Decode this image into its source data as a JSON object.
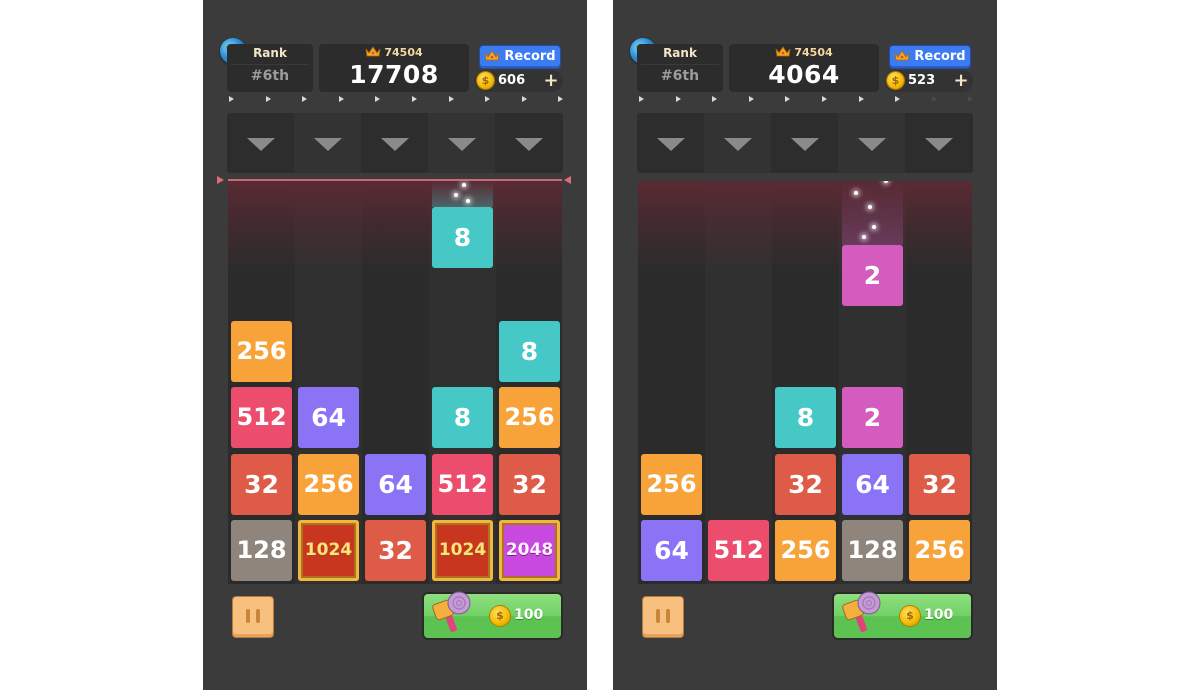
{
  "colors": {
    "tile_2": "#d45cbf",
    "tile_8": "#45c8c6",
    "tile_32": "#dd5b47",
    "tile_64": "#8a74f5",
    "tile_128": "#8f857c",
    "tile_256": "#f7a33a",
    "tile_512": "#ec4d6c",
    "tile_1024": "#c9361f",
    "tile_2048": "#c749e0"
  },
  "screens": [
    {
      "rank_label": "Rank",
      "rank_value": "#6th",
      "best_score": "74504",
      "score": "17708",
      "record_label": "Record",
      "coins": "606",
      "plus_label": "+",
      "progress_arrows_lit": 10,
      "progress_arrows_total": 10,
      "falling_tile": {
        "col": 3,
        "value": "8",
        "color_key": "tile_8"
      },
      "columns": [
        [
          "128",
          "32",
          "512",
          "256"
        ],
        [
          "1024",
          "256",
          "64"
        ],
        [
          "32",
          "64"
        ],
        [
          "1024",
          "512",
          "8"
        ],
        [
          "2048",
          "32",
          "256",
          "8"
        ]
      ],
      "hammer_price": "100",
      "coin_glyph": "$"
    },
    {
      "rank_label": "Rank",
      "rank_value": "#6th",
      "best_score": "74504",
      "score": "4064",
      "record_label": "Record",
      "coins": "523",
      "plus_label": "+",
      "progress_arrows_lit": 8,
      "progress_arrows_total": 10,
      "falling_tile": {
        "col": 3,
        "value": "2",
        "color_key": "tile_2"
      },
      "columns": [
        [
          "64",
          "256"
        ],
        [
          "512"
        ],
        [
          "256",
          "32",
          "8"
        ],
        [
          "128",
          "64",
          "2"
        ],
        [
          "256",
          "32"
        ]
      ],
      "hammer_price": "100",
      "coin_glyph": "$"
    }
  ]
}
